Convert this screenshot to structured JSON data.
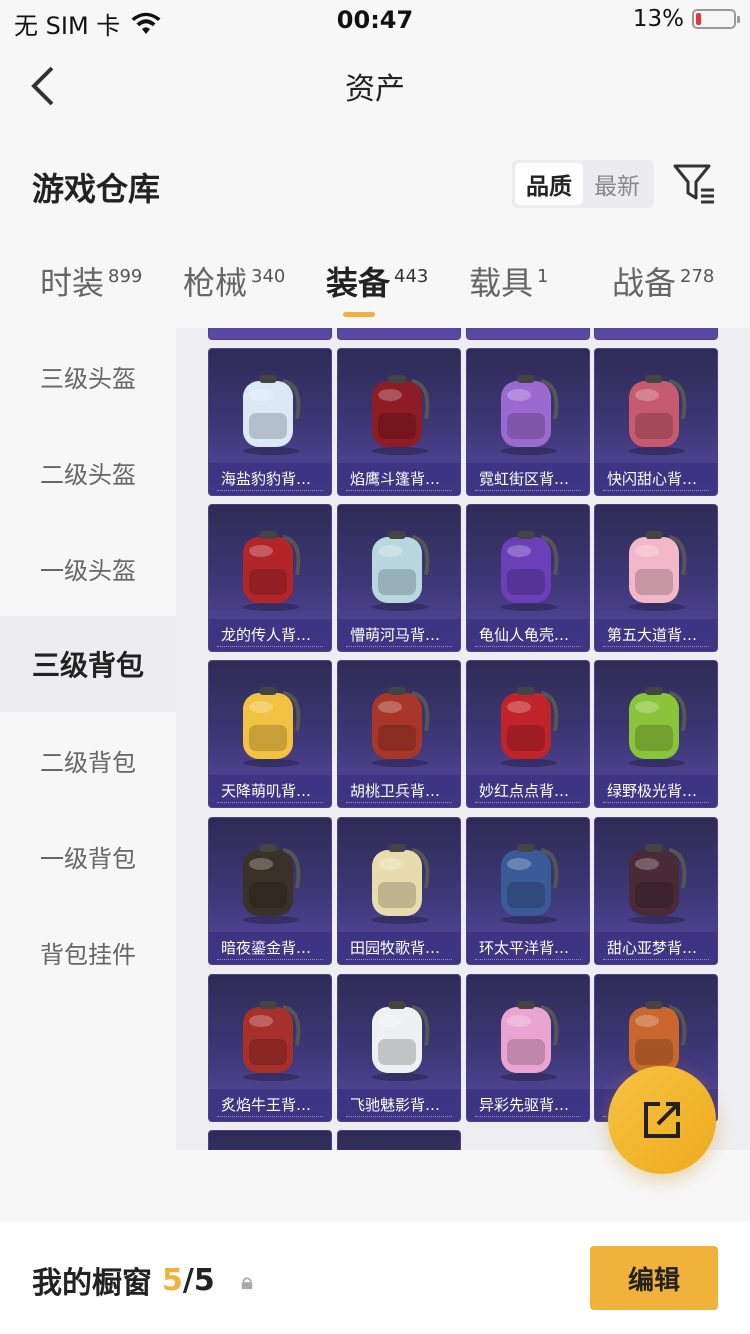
{
  "status_bar": {
    "carrier": "无 SIM 卡",
    "time": "00:47",
    "battery": "13%",
    "battery_level": 0.13
  },
  "nav": {
    "title": "资产"
  },
  "warehouse": {
    "title": "游戏仓库",
    "sort_options": [
      "品质",
      "最新"
    ],
    "active_sort": "品质"
  },
  "tabs": [
    {
      "label": "时装",
      "count": "899"
    },
    {
      "label": "枪械",
      "count": "340"
    },
    {
      "label": "装备",
      "count": "443",
      "active": true
    },
    {
      "label": "载具",
      "count": "1"
    },
    {
      "label": "战备",
      "count": "278"
    }
  ],
  "sidebar": [
    {
      "label": "三级头盔"
    },
    {
      "label": "二级头盔"
    },
    {
      "label": "一级头盔"
    },
    {
      "label": "三级背包",
      "active": true
    },
    {
      "label": "二级背包"
    },
    {
      "label": "一级背包"
    },
    {
      "label": "背包挂件"
    }
  ],
  "items": [
    {
      "name": "海盐豹豹背…",
      "icon": "backpack-icon",
      "color": "#dbe9f6"
    },
    {
      "name": "焰鹰斗篷背…",
      "icon": "backpack-icon",
      "color": "#8e1c24"
    },
    {
      "name": "霓虹街区背…",
      "icon": "backpack-icon",
      "color": "#9b6ad0"
    },
    {
      "name": "快闪甜心背…",
      "icon": "backpack-icon",
      "color": "#c65a6e"
    },
    {
      "name": "龙的传人背…",
      "icon": "backpack-icon",
      "color": "#b2262a"
    },
    {
      "name": "懵萌河马背…",
      "icon": "backpack-icon",
      "color": "#b8d8e0"
    },
    {
      "name": "龟仙人龟壳…",
      "icon": "backpack-icon",
      "color": "#6a3fb8"
    },
    {
      "name": "第五大道背…",
      "icon": "backpack-icon",
      "color": "#f2b8c8"
    },
    {
      "name": "天降萌叽背…",
      "icon": "backpack-icon",
      "color": "#f2c242"
    },
    {
      "name": "胡桃卫兵背…",
      "icon": "backpack-icon",
      "color": "#a8372a"
    },
    {
      "name": "妙红点点背…",
      "icon": "backpack-icon",
      "color": "#c0242a"
    },
    {
      "name": "绿野极光背…",
      "icon": "backpack-icon",
      "color": "#8ac43a"
    },
    {
      "name": "暗夜鎏金背…",
      "icon": "backpack-icon",
      "color": "#3a3228"
    },
    {
      "name": "田园牧歌背…",
      "icon": "backpack-icon",
      "color": "#e8dcae"
    },
    {
      "name": "环太平洋背…",
      "icon": "backpack-icon",
      "color": "#3a5a98"
    },
    {
      "name": "甜心亚梦背…",
      "icon": "backpack-icon",
      "color": "#4a2a36"
    },
    {
      "name": "炙焰牛王背…",
      "icon": "backpack-icon",
      "color": "#a8302a"
    },
    {
      "name": "飞驰魅影背…",
      "icon": "backpack-icon",
      "color": "#eef0f2"
    },
    {
      "name": "异彩先驱背…",
      "icon": "backpack-icon",
      "color": "#e9a4d2"
    },
    {
      "name": "",
      "icon": "backpack-icon",
      "color": "#c9672e"
    }
  ],
  "showcase": {
    "label": "我的橱窗",
    "current": "5",
    "total": "/5"
  },
  "edit_button": {
    "label": "编辑"
  },
  "colors": {
    "accent": "#f0b23a",
    "card_bg": "#3e3878"
  }
}
